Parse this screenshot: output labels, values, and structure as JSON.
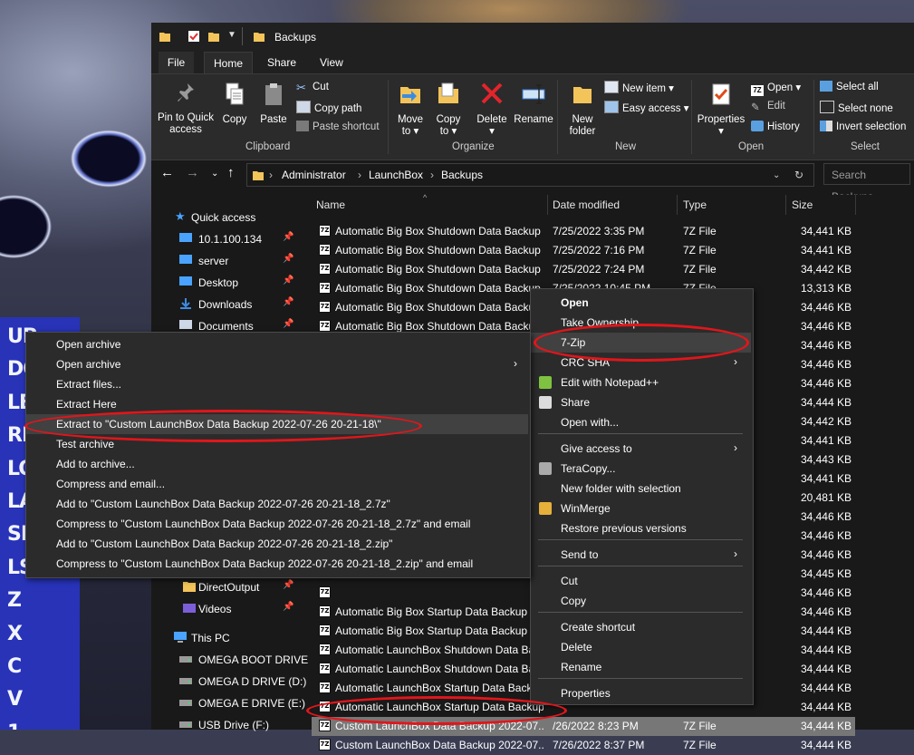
{
  "desktop": {
    "letters": [
      "UP",
      "DO",
      "LE",
      "RI",
      "LO",
      "LA",
      "SP",
      "LS",
      "Z",
      "X",
      "C",
      "V",
      "1"
    ]
  },
  "window": {
    "title": "Backups"
  },
  "menu_tabs": [
    "File",
    "Home",
    "Share",
    "View"
  ],
  "ribbon": {
    "pin_label": "Pin to Quick access",
    "copy_label": "Copy",
    "paste_label": "Paste",
    "cut_label": "Cut",
    "copy_path_label": "Copy path",
    "paste_shortcut_label": "Paste shortcut",
    "move_to_label": "Move to",
    "copy_to_label": "Copy to",
    "delete_label": "Delete",
    "rename_label": "Rename",
    "new_folder_label": "New folder",
    "new_item_label": "New item",
    "easy_access_label": "Easy access",
    "properties_label": "Properties",
    "open_label": "Open",
    "edit_label": "Edit",
    "history_label": "History",
    "select_all_label": "Select all",
    "select_none_label": "Select none",
    "invert_selection_label": "Invert selection",
    "groups": {
      "clipboard": "Clipboard",
      "organize": "Organize",
      "new": "New",
      "open": "Open",
      "select": "Select"
    }
  },
  "address": {
    "crumbs": [
      "Administrator",
      "LaunchBox",
      "Backups"
    ],
    "search_placeholder": "Search Backups"
  },
  "nav": {
    "quick_access": "Quick access",
    "items": [
      "10.1.100.134",
      "server",
      "Desktop",
      "Downloads",
      "Documents"
    ],
    "lower_items": [
      "DirectOutput",
      "Videos"
    ],
    "this_pc": "This PC",
    "drives": [
      "OMEGA BOOT DRIVE",
      "OMEGA D DRIVE (D:)",
      "OMEGA E DRIVE (E:)",
      "USB Drive (F:)"
    ]
  },
  "columns": {
    "name": "Name",
    "date": "Date modified",
    "type": "Type",
    "size": "Size"
  },
  "files": [
    {
      "name": "Automatic Big Box Shutdown Data Backup",
      "date": "7/25/2022 3:35 PM",
      "type": "7Z File",
      "size": "34,441 KB"
    },
    {
      "name": "Automatic Big Box Shutdown Data Backup",
      "date": "7/25/2022 7:16 PM",
      "type": "7Z File",
      "size": "34,441 KB"
    },
    {
      "name": "Automatic Big Box Shutdown Data Backup",
      "date": "7/25/2022 7:24 PM",
      "type": "7Z File",
      "size": "34,442 KB"
    },
    {
      "name": "Automatic Big Box Shutdown Data Backup",
      "date": "7/25/2022 10:45 PM",
      "type": "7Z File",
      "size": "13,313 KB"
    },
    {
      "name": "Automatic Big Box Shutdown Data Backup",
      "date": "",
      "type": "",
      "size": "34,446 KB"
    },
    {
      "name": "Automatic Big Box Shutdown Data Backup",
      "date": "",
      "type": "",
      "size": "34,446 KB"
    },
    {
      "name": "",
      "date": "",
      "type": "",
      "size": "34,446 KB"
    },
    {
      "name": "",
      "date": "",
      "type": "",
      "size": "34,446 KB"
    },
    {
      "name": "",
      "date": "",
      "type": "",
      "size": "34,446 KB"
    },
    {
      "name": "",
      "date": "",
      "type": "",
      "size": "34,444 KB"
    },
    {
      "name": "",
      "date": "",
      "type": "",
      "size": "34,442 KB"
    },
    {
      "name": "",
      "date": "",
      "type": "",
      "size": "34,441 KB"
    },
    {
      "name": "",
      "date": "",
      "type": "",
      "size": "34,443 KB"
    },
    {
      "name": "",
      "date": "",
      "type": "",
      "size": "34,441 KB"
    },
    {
      "name": "",
      "date": "",
      "type": "",
      "size": "20,481 KB"
    },
    {
      "name": "",
      "date": "",
      "type": "",
      "size": "34,446 KB"
    },
    {
      "name": "",
      "date": "",
      "type": "",
      "size": "34,446 KB"
    },
    {
      "name": "",
      "date": "",
      "type": "",
      "size": "34,446 KB"
    },
    {
      "name": "",
      "date": "",
      "type": "",
      "size": "34,445 KB"
    },
    {
      "name": "",
      "date": "",
      "type": "",
      "size": "34,446 KB"
    },
    {
      "name": "Automatic Big Box Startup Data Backup",
      "date": "",
      "type": "",
      "size": "34,446 KB"
    },
    {
      "name": "Automatic Big Box Startup Data Backup",
      "date": "",
      "type": "",
      "size": "34,444 KB"
    },
    {
      "name": "Automatic LaunchBox Shutdown Data Backup",
      "date": "",
      "type": "",
      "size": "34,444 KB"
    },
    {
      "name": "Automatic LaunchBox Shutdown Data Backup",
      "date": "",
      "type": "",
      "size": "34,444 KB"
    },
    {
      "name": "Automatic LaunchBox Startup Data Backup",
      "date": "",
      "type": "",
      "size": "34,444 KB"
    },
    {
      "name": "Automatic LaunchBox Startup Data Backup",
      "date": "",
      "type": "",
      "size": "34,444 KB"
    },
    {
      "name": "Custom LaunchBox Data Backup 2022-07...",
      "date": "/26/2022 8:23 PM",
      "type": "7Z File",
      "size": "34,444 KB"
    },
    {
      "name": "Custom LaunchBox Data Backup 2022-07...",
      "date": "7/26/2022 8:37 PM",
      "type": "7Z File",
      "size": "34,444 KB"
    }
  ],
  "right_menu": {
    "items": [
      "Open",
      "Take Ownership",
      "7-Zip",
      "CRC SHA",
      "Edit with Notepad++",
      "Share",
      "Open with...",
      "Give access to",
      "TeraCopy...",
      "New folder with selection",
      "WinMerge",
      "Restore previous versions",
      "Send to",
      "Cut",
      "Copy",
      "Create shortcut",
      "Delete",
      "Rename",
      "Properties"
    ]
  },
  "zip_menu": {
    "items": [
      "Open archive",
      "Open archive",
      "Extract files...",
      "Extract Here",
      "Extract to \"Custom LaunchBox Data Backup 2022-07-26 20-21-18\\\"",
      "Test archive",
      "Add to archive...",
      "Compress and email...",
      "Add to \"Custom LaunchBox Data Backup 2022-07-26 20-21-18_2.7z\"",
      "Compress to \"Custom LaunchBox Data Backup 2022-07-26 20-21-18_2.7z\" and email",
      "Add to \"Custom LaunchBox Data Backup 2022-07-26 20-21-18_2.zip\"",
      "Compress to \"Custom LaunchBox Data Backup 2022-07-26 20-21-18_2.zip\" and email"
    ]
  },
  "colors": {
    "annotation": "#e0161b",
    "accent": "#f0c040"
  }
}
